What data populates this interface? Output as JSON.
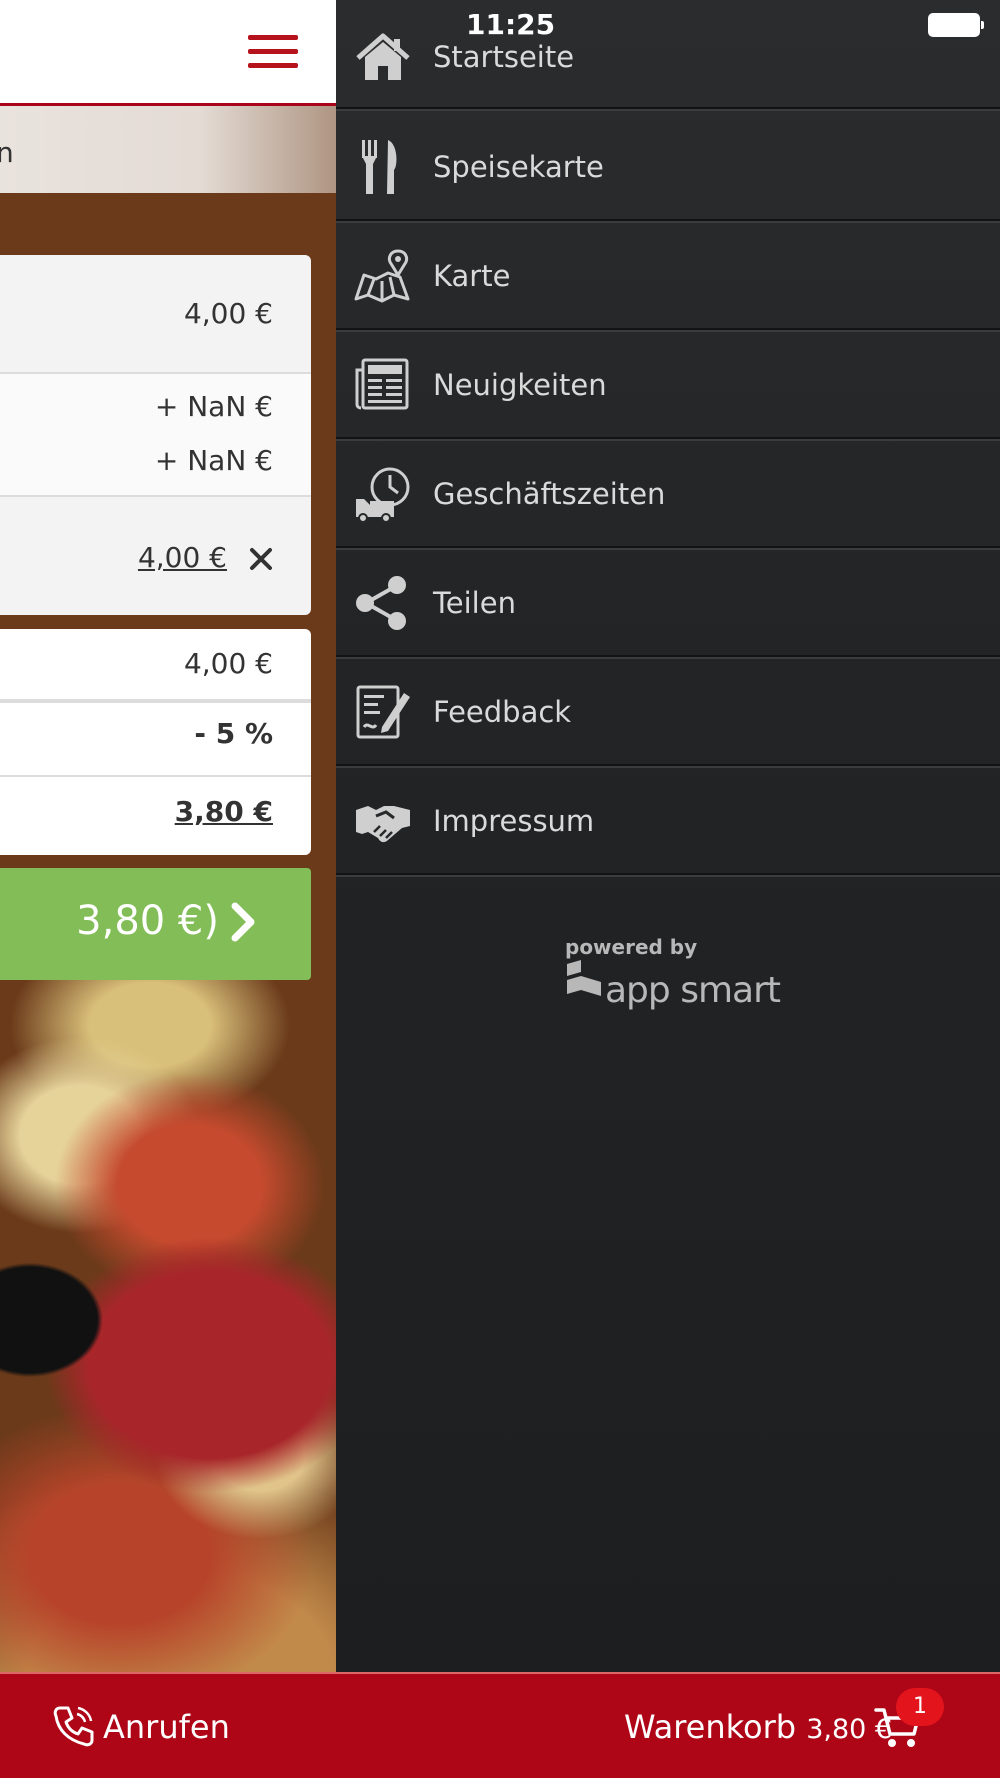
{
  "status_bar": {
    "time": "11:25"
  },
  "left_page": {
    "banner_text": "n",
    "item_price": "4,00 €",
    "extras": [
      "+ NaN €",
      "+ NaN €"
    ],
    "selected_price": "4,00 €",
    "remove_icon": "close-icon",
    "summary": {
      "subtotal": "4,00 €",
      "discount": "- 5 %",
      "total": "3,80 €"
    },
    "checkout_label": "3,80 €)"
  },
  "menu": {
    "items": [
      {
        "label": "Startseite",
        "icon": "home-icon"
      },
      {
        "label": "Speisekarte",
        "icon": "cutlery-icon"
      },
      {
        "label": "Karte",
        "icon": "map-icon"
      },
      {
        "label": "Neuigkeiten",
        "icon": "news-icon"
      },
      {
        "label": "Geschäftszeiten",
        "icon": "delivery-clock-icon"
      },
      {
        "label": "Teilen",
        "icon": "share-icon"
      },
      {
        "label": "Feedback",
        "icon": "feedback-icon"
      },
      {
        "label": "Impressum",
        "icon": "handshake-icon"
      }
    ],
    "powered_by": "powered by",
    "brand": "app smart"
  },
  "bottom_bar": {
    "call_label": "Anrufen",
    "cart_label": "Warenkorb",
    "cart_total": "3,80 €",
    "cart_count": "1"
  },
  "colors": {
    "brand_red": "#ae0517",
    "checkout_green": "#82bd57",
    "drawer_bg": "#222426"
  }
}
